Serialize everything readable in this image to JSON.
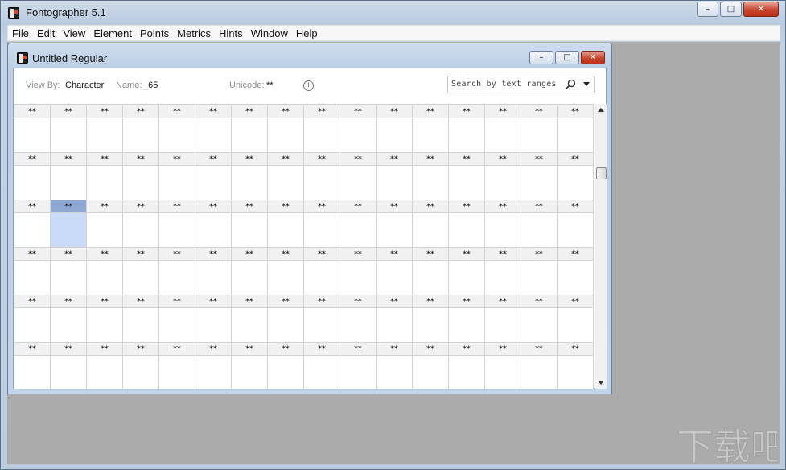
{
  "app": {
    "title": "Fontographer 5.1",
    "controls": {
      "minimize": "–",
      "restore": "□",
      "close": "✕"
    }
  },
  "menu": [
    "File",
    "Edit",
    "View",
    "Element",
    "Points",
    "Metrics",
    "Hints",
    "Window",
    "Help"
  ],
  "doc": {
    "title": "Untitled Regular",
    "controls": {
      "minimize": "–",
      "restore": "□",
      "close": "✕"
    }
  },
  "toolbar": {
    "view_by_label": "View By:",
    "view_by_value": "Character",
    "name_label": "Name:",
    "name_value": "_65",
    "unicode_label": "Unicode:",
    "unicode_value": "**",
    "add_symbol": "+",
    "search_placeholder": "Search by text ranges"
  },
  "grid": {
    "columns": 16,
    "rows": 6,
    "cell_label": "**",
    "selected": {
      "row": 2,
      "col": 1
    },
    "selected_color": "#c9dbf7",
    "selected_header_color": "#8fa7d3"
  },
  "watermark_text": "下载吧"
}
